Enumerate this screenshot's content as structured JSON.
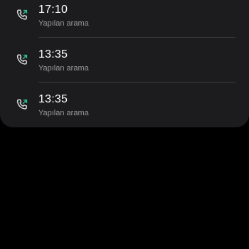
{
  "call_log": {
    "entries": [
      {
        "time": "17:10",
        "type": "Yapılan arama",
        "icon": "outgoing-call-icon"
      },
      {
        "time": "13:35",
        "type": "Yapılan arama",
        "icon": "outgoing-call-icon"
      },
      {
        "time": "13:35",
        "type": "Yapılan arama",
        "icon": "outgoing-call-icon"
      }
    ]
  },
  "colors": {
    "background": "#000000",
    "card": "#1c1c1e",
    "phone_icon": "#d8d8d8",
    "outgoing_arrow": "#2fbf8f",
    "primary_text": "#ffffff",
    "secondary_text": "#9a9a9a",
    "divider": "#3a3a3c"
  }
}
